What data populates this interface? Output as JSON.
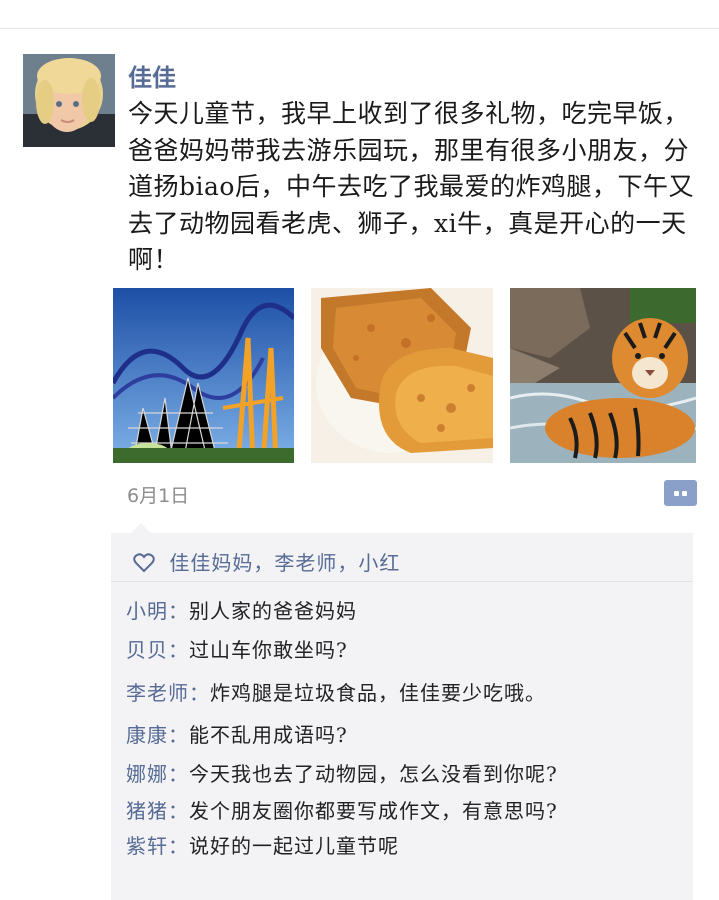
{
  "post": {
    "author": "佳佳",
    "text": "今天儿童节，我早上收到了很多礼物，吃完早饭，爸爸妈妈带我去游乐园玩，那里有很多小朋友，分道扬biao后，中午去吃了我最爱的炸鸡腿，下午又去了动物园看老虎、狮子，xi牛，真是开心的一天啊！",
    "date": "6月1日",
    "photos": [
      "roller-coaster-photo",
      "fried-chicken-photo",
      "tiger-photo"
    ]
  },
  "likes": {
    "icon": "heart-icon",
    "names": "佳佳妈妈，李老师，小红"
  },
  "comments": [
    {
      "name": "小明",
      "text": "别人家的爸爸妈妈"
    },
    {
      "name": "贝贝",
      "text": "过山车你敢坐吗?"
    },
    {
      "name": "李老师",
      "text": "炸鸡腿是垃圾食品，佳佳要少吃哦。"
    },
    {
      "name": "康康",
      "text": "能不乱用成语吗?"
    },
    {
      "name": "娜娜",
      "text": "今天我也去了动物园，怎么没看到你呢?"
    },
    {
      "name": "猪猪",
      "text": "发个朋友圈你都要写成作文，有意思吗?"
    },
    {
      "name": "紫轩",
      "text": "说好的一起过儿童节呢"
    }
  ],
  "colors": {
    "link": "#576b95",
    "panel": "#f3f3f5",
    "button": "#8aa0c8"
  }
}
